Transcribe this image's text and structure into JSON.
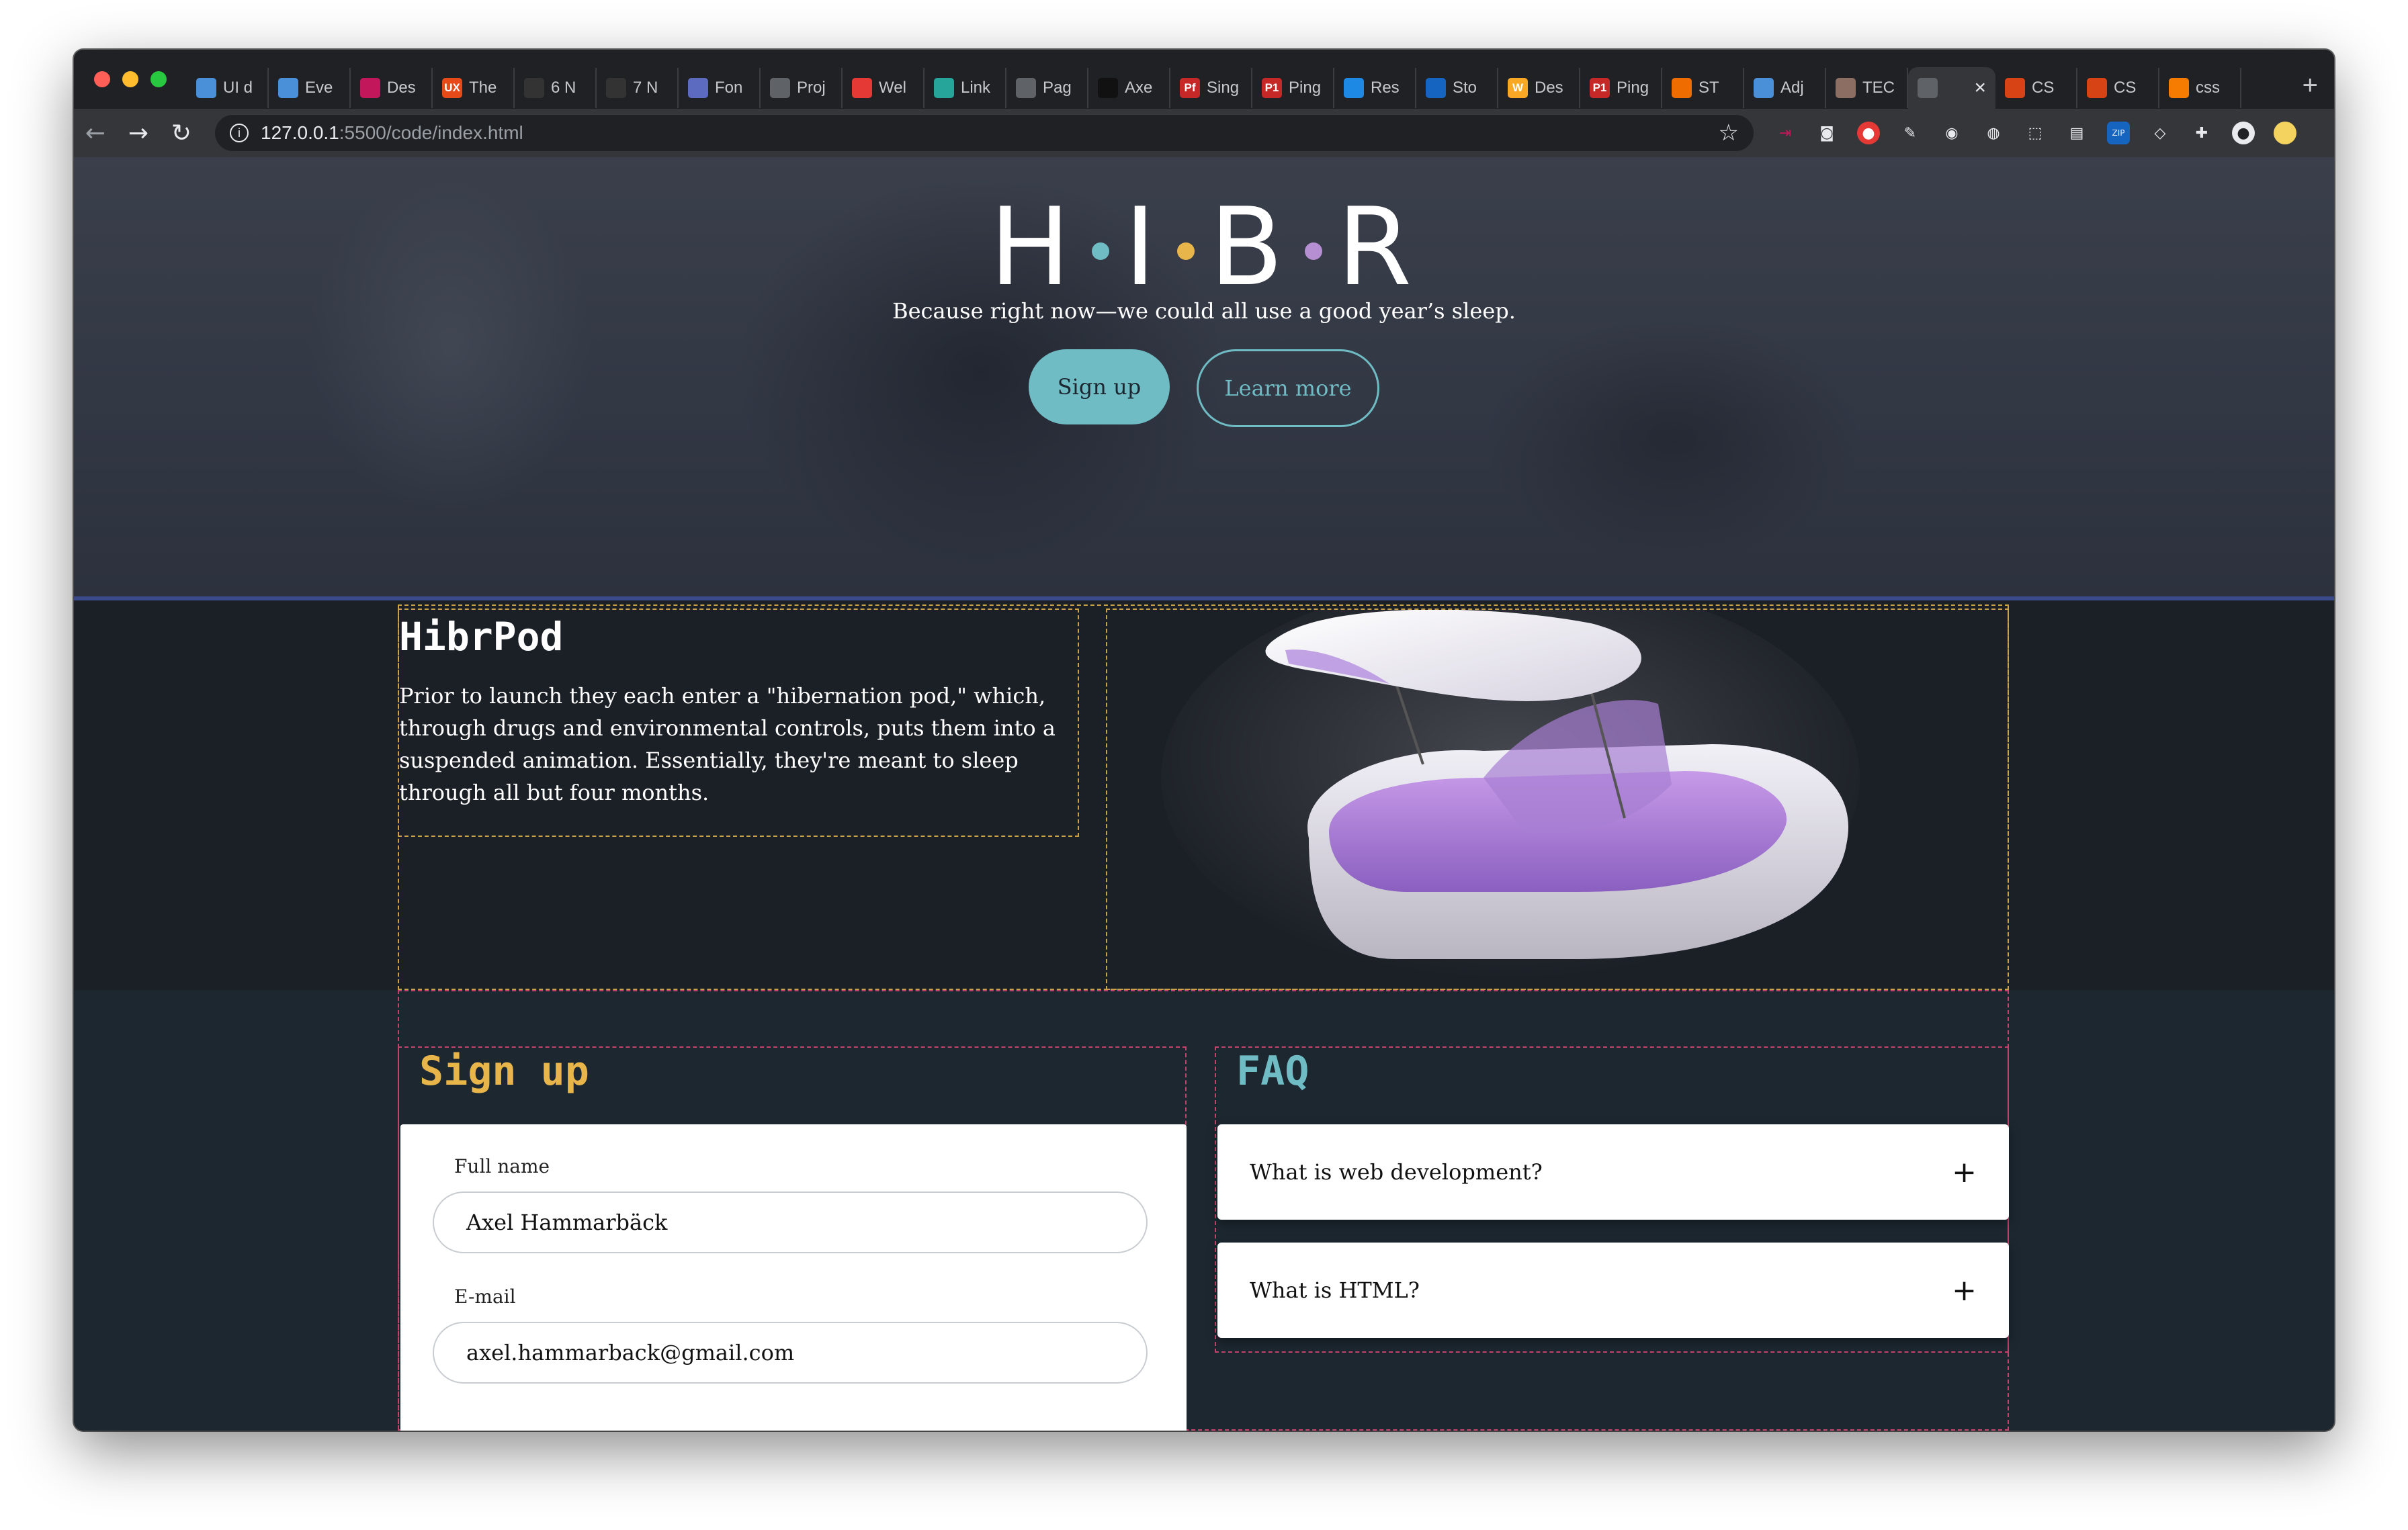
{
  "browser": {
    "tabs": [
      {
        "label": "UI d",
        "favicon_color": "#4a90d9"
      },
      {
        "label": "Eve",
        "favicon_color": "#4a90d9"
      },
      {
        "label": "Des",
        "favicon_color": "#c2185b"
      },
      {
        "label": "The",
        "favicon_color": "#e64a19",
        "favicon_text": "UX"
      },
      {
        "label": "6 N",
        "favicon_color": "#333333"
      },
      {
        "label": "7 N",
        "favicon_color": "#333333"
      },
      {
        "label": "Fon",
        "favicon_color": "#5c6bc0"
      },
      {
        "label": "Proj",
        "favicon_color": "#5f6368"
      },
      {
        "label": "Wel",
        "favicon_color": "#e53935"
      },
      {
        "label": "Link",
        "favicon_color": "#26a69a"
      },
      {
        "label": "Pag",
        "favicon_color": "#5f6368"
      },
      {
        "label": "Axe",
        "favicon_color": "#111111"
      },
      {
        "label": "Sing",
        "favicon_color": "#c62828",
        "favicon_text": "Pf"
      },
      {
        "label": "Ping",
        "favicon_color": "#c62828",
        "favicon_text": "P1"
      },
      {
        "label": "Res",
        "favicon_color": "#1e88e5"
      },
      {
        "label": "Sto",
        "favicon_color": "#1565c0"
      },
      {
        "label": "Des",
        "favicon_color": "#f9a825",
        "favicon_text": "W"
      },
      {
        "label": "Ping",
        "favicon_color": "#c62828",
        "favicon_text": "P1"
      },
      {
        "label": "ST",
        "favicon_color": "#ef6c00"
      },
      {
        "label": "Adj",
        "favicon_color": "#4a90d9"
      },
      {
        "label": "TEC",
        "favicon_color": "#8d6e63"
      },
      {
        "label": "",
        "favicon_color": "#5f6368",
        "active": true
      },
      {
        "label": "CS",
        "favicon_color": "#d84315"
      },
      {
        "label": "CS",
        "favicon_color": "#d84315"
      },
      {
        "label": "css",
        "favicon_color": "#f57c00"
      }
    ],
    "url_host": "127.0.0.1",
    "url_rest": ":5500/code/index.html"
  },
  "hero": {
    "logo_letters": [
      "H",
      "I",
      "B",
      "R"
    ],
    "logo_dot_colors": [
      "#6fbcc4",
      "#e8b54a",
      "#b58fd1"
    ],
    "tagline": "Because right now—we could all use a good year’s sleep.",
    "primary_button": "Sign up",
    "secondary_button": "Learn more"
  },
  "pod": {
    "title": "HibrPod",
    "description": "Prior to launch they each enter a \"hibernation pod,\" which, through drugs and environmental controls, puts them into a suspended animation. Essentially, they're meant to sleep through all but four months."
  },
  "signup": {
    "heading": "Sign up",
    "fields": [
      {
        "label": "Full name",
        "value": "Axel Hammarbäck"
      },
      {
        "label": "E-mail",
        "value": "axel.hammarback@gmail.com"
      }
    ]
  },
  "faq": {
    "heading": "FAQ",
    "items": [
      {
        "question": "What is web development?",
        "icon": "plus-icon"
      },
      {
        "question": "What is HTML?",
        "icon": "plus-icon"
      }
    ]
  },
  "colors": {
    "accent_teal": "#6fbcc4",
    "accent_yellow": "#e8b54a",
    "accent_purple": "#b58fd1",
    "page_dark": "#1b1f26"
  }
}
